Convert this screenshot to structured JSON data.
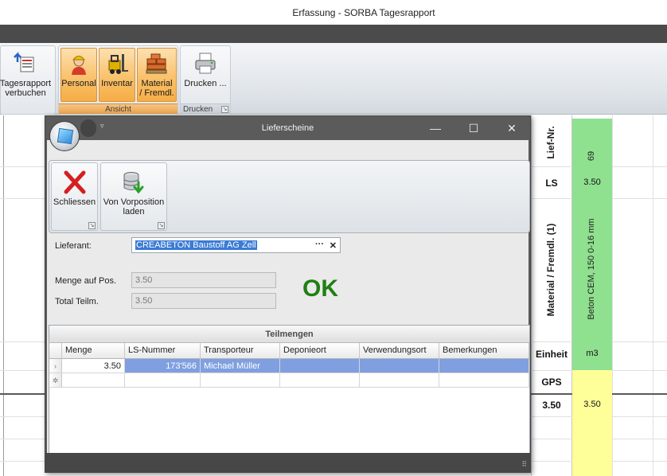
{
  "app": {
    "title": "Erfassung - SORBA Tagesrapport"
  },
  "ribbon": {
    "buttons": [
      {
        "label_line1": "Tagesrapport",
        "label_line2": "verbuchen"
      },
      {
        "label_line1": "Personal",
        "label_line2": ""
      },
      {
        "label_line1": "Inventar",
        "label_line2": ""
      },
      {
        "label_line1": "Material",
        "label_line2": "/ Fremdl."
      },
      {
        "label_line1": "Drucken ...",
        "label_line2": ""
      }
    ],
    "groups": {
      "ansicht": "Ansicht",
      "drucken": "Drucken"
    }
  },
  "background_grid": {
    "columns": [
      {
        "header": "Lief-Nr.",
        "value": "69"
      },
      {
        "header": "LS",
        "value": "3.50"
      },
      {
        "header": "Material / Fremdl. (1)",
        "value": "Beton CEM, 150 0-16 mm"
      },
      {
        "header": "Einheit",
        "value": "m3"
      },
      {
        "header": "GPS",
        "value": ""
      }
    ],
    "total": {
      "label": "3.50",
      "value": "3.50"
    },
    "colors": {
      "green": "#8fe08f",
      "yellow": "#ffff99"
    }
  },
  "dialog": {
    "title": "Lieferscheine",
    "quick_access_arrow": "▿",
    "window_buttons": {
      "minimize": "—",
      "maximize": "☐",
      "close": "✕"
    },
    "ribbon_buttons": [
      {
        "label_line1": "Schliessen",
        "label_line2": ""
      },
      {
        "label_line1": "Von Vorposition",
        "label_line2": "laden"
      }
    ],
    "lieferant": {
      "label": "Lieferant:",
      "value": "CREABETON Baustoff AG Zell",
      "ellipsis": "···",
      "clear": "✕"
    },
    "menge_auf_pos": {
      "label": "Menge auf Pos.",
      "value": "3.50"
    },
    "total_teilm": {
      "label": "Total Teilm.",
      "value": "3.50"
    },
    "status": {
      "text": "OK",
      "color": "#1f7f12"
    },
    "grid": {
      "caption": "Teilmengen",
      "headers": [
        "Menge",
        "LS-Nummer",
        "Transporteur",
        "Deponieort",
        "Verwendungsort",
        "Bemerkungen"
      ],
      "rows": [
        {
          "menge": "3.50",
          "ls_nummer": "173'566",
          "transporteur": "Michael Müller",
          "deponieort": "",
          "verwendungsort": "",
          "bemerkungen": ""
        }
      ],
      "row_indicator": "›",
      "new_row_indicator": "✲"
    }
  }
}
